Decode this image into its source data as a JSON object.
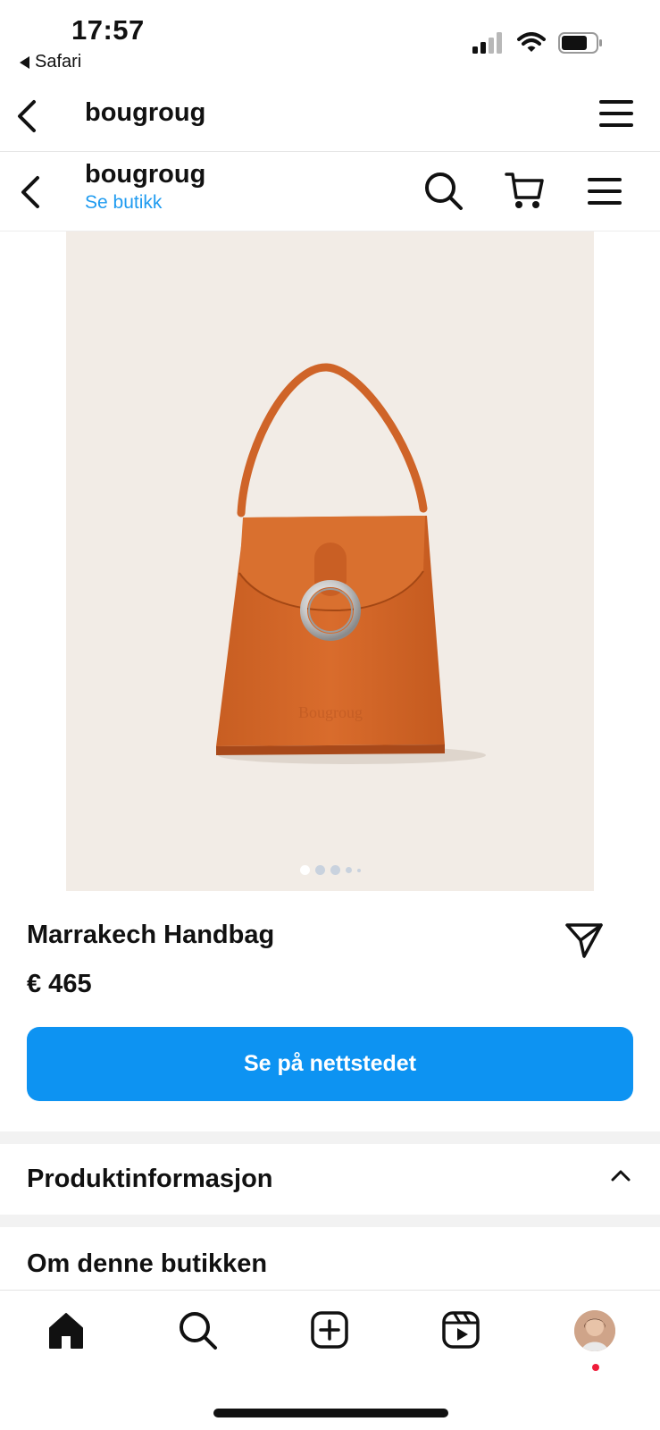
{
  "status_bar": {
    "time": "17:57",
    "back_app_label": "Safari",
    "icons": [
      "signal-icon",
      "wifi-icon",
      "battery-icon"
    ]
  },
  "top_nav": {
    "title": "bougroug",
    "icons": [
      "back-arrow-icon",
      "hamburger-menu-icon"
    ]
  },
  "shop_header": {
    "title": "bougroug",
    "subtitle": "Se butikk",
    "icons": [
      "back-arrow-icon",
      "search-icon",
      "cart-icon",
      "hamburger-menu-icon"
    ]
  },
  "product": {
    "image_icon": "orange-handbag-image",
    "carousel_total": 5,
    "carousel_active": 1,
    "name": "Marrakech Handbag",
    "price": "€ 465",
    "cta_label": "Se på nettstedet",
    "share_icon": "send-icon"
  },
  "sections": [
    {
      "title": "Produktinformasjon",
      "icon": "chevron-up-icon"
    },
    {
      "title": "Om denne butikken"
    }
  ],
  "tab_bar": {
    "tabs": [
      "home-icon",
      "search-icon",
      "create-post-icon",
      "reels-icon",
      "profile-avatar"
    ],
    "active": "home-icon"
  },
  "colors": {
    "accent": "#0d93f2",
    "link": "#1f9bf0",
    "product_bg": "#f2ece6",
    "bag": "#d4682a",
    "notification": "#ef1c3a"
  }
}
